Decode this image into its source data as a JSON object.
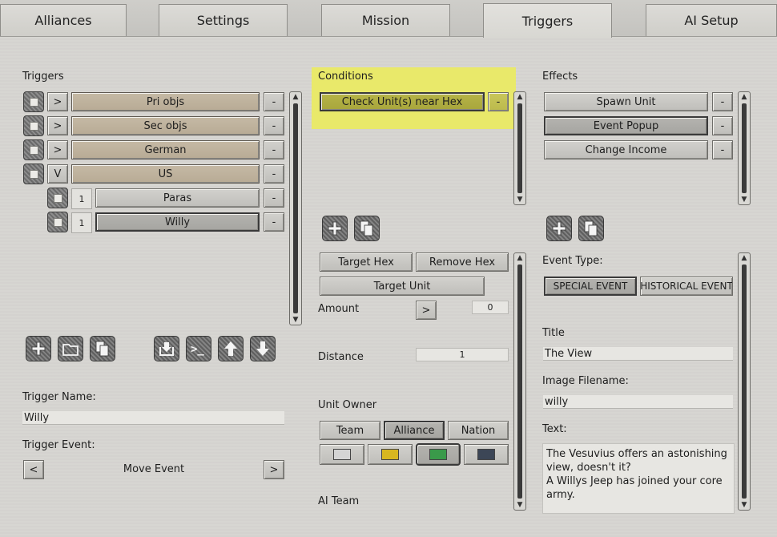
{
  "tabs": [
    {
      "label": "Alliances",
      "active": false
    },
    {
      "label": "Settings",
      "active": false
    },
    {
      "label": "Mission",
      "active": false
    },
    {
      "label": "Triggers",
      "active": true
    },
    {
      "label": "AI Setup",
      "active": false
    }
  ],
  "triggers": {
    "heading": "Triggers",
    "items": [
      {
        "toggle": ">",
        "label": "Pri objs",
        "remove": "-"
      },
      {
        "toggle": ">",
        "label": "Sec objs",
        "remove": "-"
      },
      {
        "toggle": ">",
        "label": "German",
        "remove": "-"
      },
      {
        "toggle": "V",
        "label": "US",
        "remove": "-"
      }
    ],
    "children": [
      {
        "number": "1",
        "label": "Paras",
        "remove": "-"
      },
      {
        "number": "1",
        "label": "Willy",
        "remove": "-"
      }
    ],
    "name_label": "Trigger Name:",
    "name_value": "Willy",
    "event_label": "Trigger Event:",
    "event_value": "Move Event",
    "event_prev": "<",
    "event_next": ">",
    "icons": [
      "add-icon",
      "folder-icon",
      "copy-icon",
      "import-icon",
      "console-icon",
      "arrow-up-icon",
      "arrow-down-icon"
    ],
    "console_glyph": ">_"
  },
  "conditions": {
    "heading": "Conditions",
    "items": [
      {
        "label": "Check Unit(s) near Hex",
        "remove": "-"
      }
    ],
    "highlight_color": "#e9e96a",
    "target_hex": "Target Hex",
    "remove_hex": "Remove Hex",
    "target_unit": "Target Unit",
    "amount_label": "Amount",
    "amount_toggle": ">",
    "amount_value": "0",
    "distance_label": "Distance",
    "distance_value": "1",
    "owner_label": "Unit Owner",
    "owner_options": [
      "Team",
      "Alliance",
      "Nation"
    ],
    "owner_selected": "Alliance",
    "team_colors": [
      "#d4d4d4",
      "#d8b720",
      "#3a9a4a",
      "#3c4656"
    ],
    "ai_team_label": "AI Team"
  },
  "effects": {
    "heading": "Effects",
    "items": [
      {
        "label": "Spawn Unit",
        "remove": "-"
      },
      {
        "label": "Event Popup",
        "remove": "-"
      },
      {
        "label": "Change Income",
        "remove": "-"
      }
    ],
    "event_type_label": "Event Type:",
    "event_types": [
      "SPECIAL EVENT",
      "HISTORICAL EVENT"
    ],
    "title_label": "Title",
    "title_value": "The View",
    "image_label": "Image Filename:",
    "image_value": "willy",
    "text_label": "Text:",
    "text_value": "The Vesuvius offers an astonishing\nview, doesn't it?\nA Willys Jeep has joined your core\narmy."
  },
  "scroll_arrows": {
    "up": "▲",
    "down": "▼"
  }
}
